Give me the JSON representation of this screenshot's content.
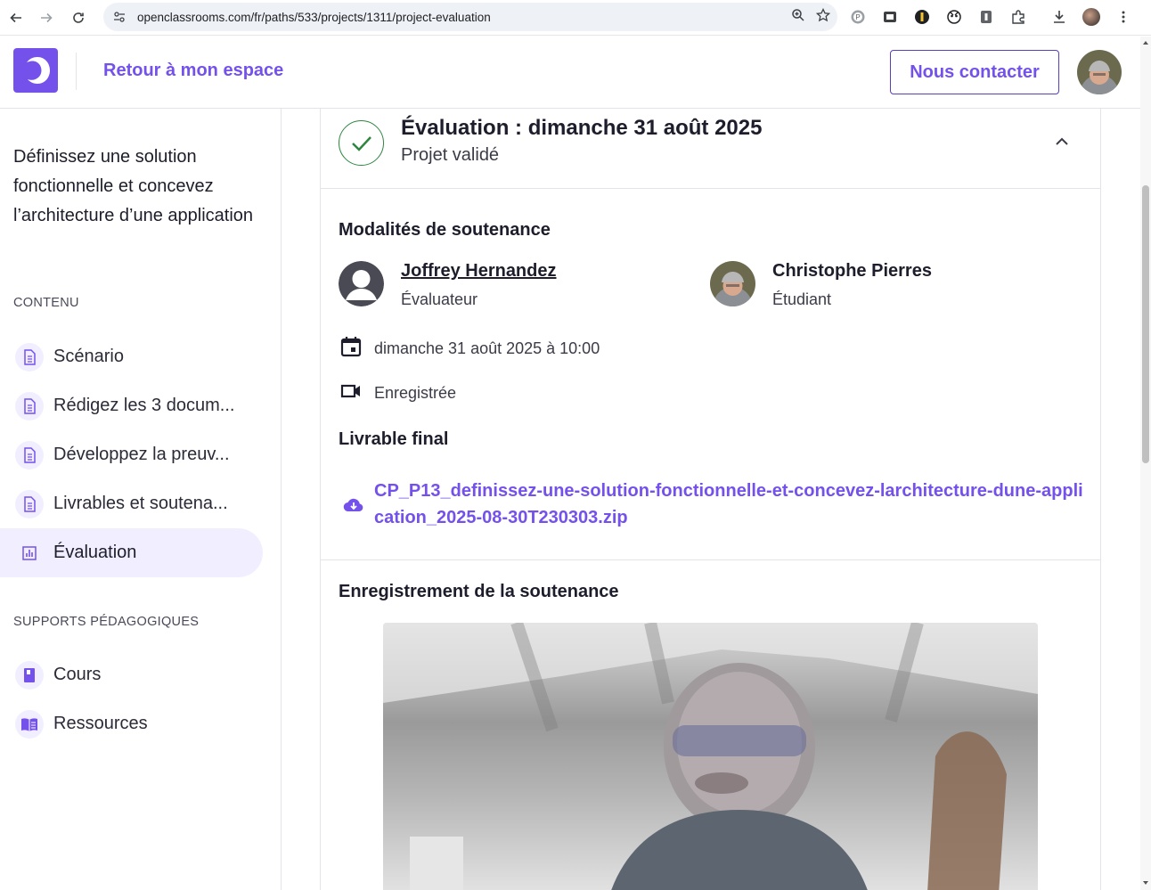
{
  "browser": {
    "url": "openclassrooms.com/fr/paths/533/projects/1311/project-evaluation"
  },
  "header": {
    "back_label": "Retour à mon espace",
    "contact_label": "Nous contacter"
  },
  "sidebar": {
    "project_title": "Définissez une solution fonctionnelle et concevez l’architecture d’une application",
    "content_heading": "CONTENU",
    "content_items": [
      {
        "label": "Scénario",
        "icon": "document-icon"
      },
      {
        "label": "Rédigez les 3 docum...",
        "icon": "document-icon"
      },
      {
        "label": "Développez la preuv...",
        "icon": "document-icon"
      },
      {
        "label": "Livrables et soutena...",
        "icon": "document-icon"
      },
      {
        "label": "Évaluation",
        "icon": "chart-icon",
        "active": true
      }
    ],
    "supports_heading": "SUPPORTS PÉDAGOGIQUES",
    "support_items": [
      {
        "label": "Cours",
        "icon": "book-icon"
      },
      {
        "label": "Ressources",
        "icon": "open-book-icon"
      }
    ]
  },
  "evaluation": {
    "title": "Évaluation : dimanche 31 août 2025",
    "status": "Projet validé",
    "modalities_heading": "Modalités de soutenance",
    "evaluator": {
      "name": "Joffrey Hernandez",
      "role": "Évaluateur"
    },
    "student": {
      "name": "Christophe Pierres",
      "role": "Étudiant"
    },
    "datetime": "dimanche 31 août 2025 à 10:00",
    "recording_status": "Enregistrée",
    "deliverable_heading": "Livrable final",
    "deliverable_file": "CP_P13_definissez-une-solution-fonctionnelle-et-concevez-larchitecture-dune-application_2025-08-30T230303.zip",
    "recording_heading": "Enregistrement de la soutenance"
  },
  "colors": {
    "brand": "#7451eb",
    "success": "#2e8540",
    "text": "#1d1d2b"
  }
}
